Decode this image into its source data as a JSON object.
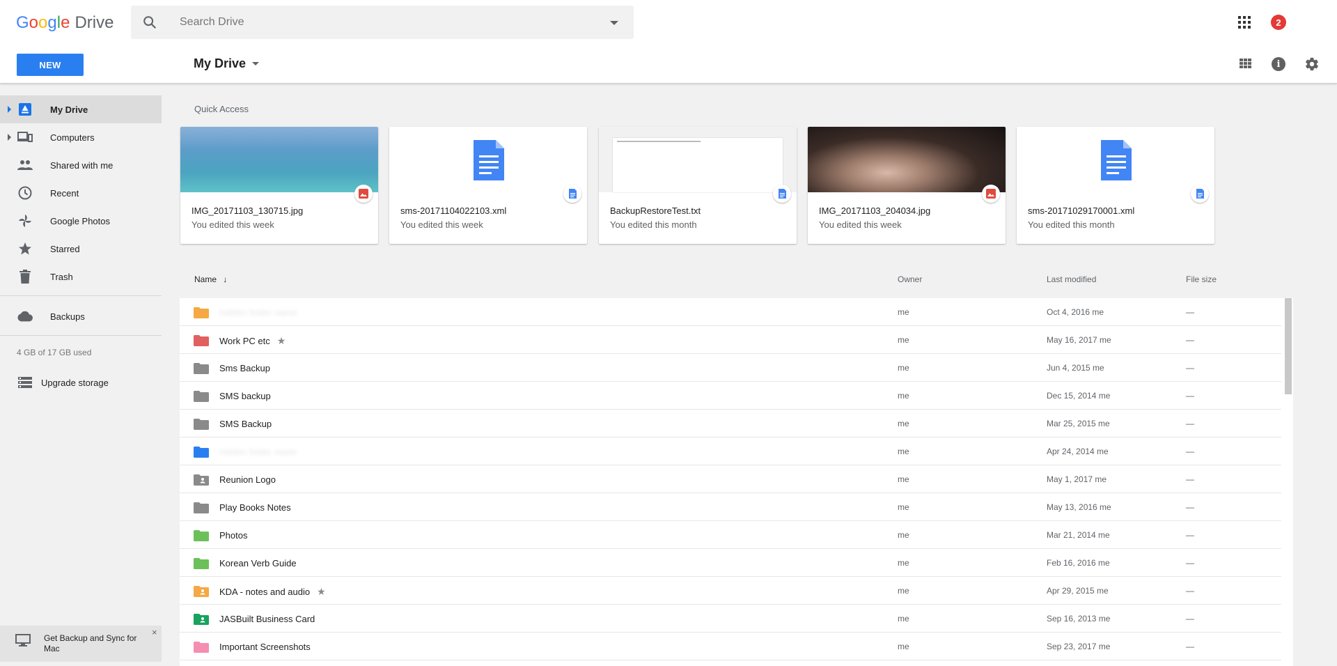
{
  "header": {
    "logo_google_letters": [
      "G",
      "o",
      "o",
      "g",
      "l",
      "e"
    ],
    "logo_product": "Drive",
    "search_placeholder": "Search Drive",
    "notification_count": "2"
  },
  "toolbar": {
    "new_label": "NEW",
    "drive_title": "My Drive"
  },
  "sidebar": {
    "items": [
      {
        "label": "My Drive",
        "icon": "my-drive-icon",
        "active": true
      },
      {
        "label": "Computers",
        "icon": "computers-icon"
      },
      {
        "label": "Shared with me",
        "icon": "shared-icon"
      },
      {
        "label": "Recent",
        "icon": "clock-icon"
      },
      {
        "label": "Google Photos",
        "icon": "photos-icon"
      },
      {
        "label": "Starred",
        "icon": "star-icon"
      },
      {
        "label": "Trash",
        "icon": "trash-icon"
      },
      {
        "label": "Backups",
        "icon": "cloud-icon"
      }
    ],
    "storage": "4 GB of 17 GB used",
    "upgrade_label": "Upgrade storage",
    "promo_text": "Get Backup and Sync for Mac",
    "promo_close": "×"
  },
  "quick_access": {
    "label": "Quick Access",
    "cards": [
      {
        "name": "IMG_20171103_130715.jpg",
        "sub": "You edited this week",
        "type": "image"
      },
      {
        "name": "sms-20171104022103.xml",
        "sub": "You edited this week",
        "type": "doc"
      },
      {
        "name": "BackupRestoreTest.txt",
        "sub": "You edited this month",
        "type": "txt"
      },
      {
        "name": "IMG_20171103_204034.jpg",
        "sub": "You edited this week",
        "type": "image"
      },
      {
        "name": "sms-20171029170001.xml",
        "sub": "You edited this month",
        "type": "doc"
      }
    ]
  },
  "list": {
    "columns": {
      "name": "Name",
      "sort_arrow": "↓",
      "owner": "Owner",
      "modified": "Last modified",
      "size": "File size"
    },
    "rows": [
      {
        "name": "",
        "owner": "me",
        "modified": "Oct 4, 2016  me",
        "size": "—",
        "color": "#f5a843",
        "shared": false,
        "starred": false
      },
      {
        "name": "Work PC etc",
        "owner": "me",
        "modified": "May 16, 2017  me",
        "size": "—",
        "color": "#e06060",
        "shared": false,
        "starred": true
      },
      {
        "name": "Sms Backup",
        "owner": "me",
        "modified": "Jun 4, 2015  me",
        "size": "—",
        "color": "#8a8a8a",
        "shared": false,
        "starred": false
      },
      {
        "name": "SMS backup",
        "owner": "me",
        "modified": "Dec 15, 2014  me",
        "size": "—",
        "color": "#8a8a8a",
        "shared": false,
        "starred": false
      },
      {
        "name": "SMS Backup",
        "owner": "me",
        "modified": "Mar 25, 2015  me",
        "size": "—",
        "color": "#8a8a8a",
        "shared": false,
        "starred": false
      },
      {
        "name": "",
        "owner": "me",
        "modified": "Apr 24, 2014  me",
        "size": "—",
        "color": "#2a7ff0",
        "shared": false,
        "starred": false
      },
      {
        "name": "Reunion Logo",
        "owner": "me",
        "modified": "May 1, 2017  me",
        "size": "—",
        "color": "#8a8a8a",
        "shared": true,
        "starred": false
      },
      {
        "name": "Play Books Notes",
        "owner": "me",
        "modified": "May 13, 2016  me",
        "size": "—",
        "color": "#8a8a8a",
        "shared": false,
        "starred": false
      },
      {
        "name": "Photos",
        "owner": "me",
        "modified": "Mar 21, 2014  me",
        "size": "—",
        "color": "#6cc05a",
        "shared": false,
        "starred": false
      },
      {
        "name": "Korean Verb Guide",
        "owner": "me",
        "modified": "Feb 16, 2016  me",
        "size": "—",
        "color": "#6cc05a",
        "shared": false,
        "starred": false
      },
      {
        "name": "KDA - notes and audio",
        "owner": "me",
        "modified": "Apr 29, 2015  me",
        "size": "—",
        "color": "#f5a843",
        "shared": true,
        "starred": true
      },
      {
        "name": "JASBuilt Business Card",
        "owner": "me",
        "modified": "Sep 16, 2013  me",
        "size": "—",
        "color": "#17a35e",
        "shared": true,
        "starred": false
      },
      {
        "name": "Important Screenshots",
        "owner": "me",
        "modified": "Sep 23, 2017  me",
        "size": "—",
        "color": "#f48fb1",
        "shared": false,
        "starred": false
      }
    ]
  },
  "colors": {
    "accent": "#2a7ff0",
    "badge": "#e53935"
  }
}
